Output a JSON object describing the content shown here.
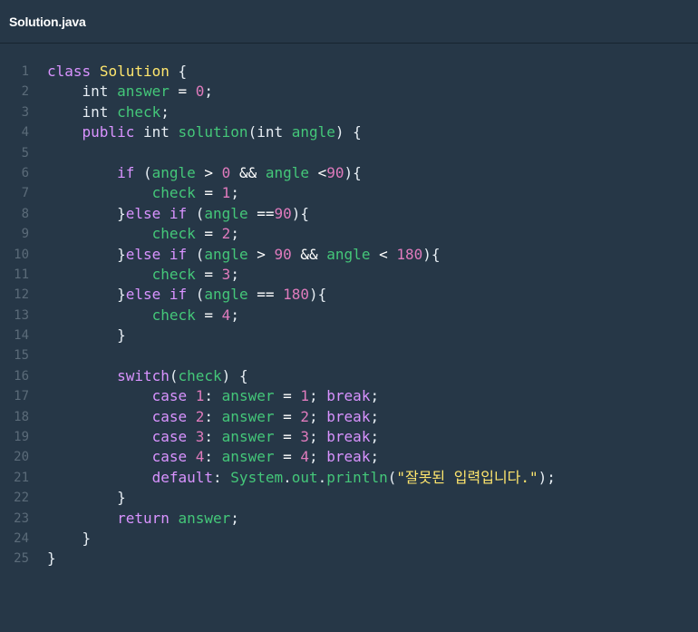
{
  "file_tab": {
    "title": "Solution.java"
  },
  "colors": {
    "background": "#263747",
    "keyword": "#d993ff",
    "class_name": "#ffe66d",
    "variable": "#44c779",
    "number": "#e07bbd",
    "string": "#ffe66d",
    "line_number": "#5b6b79"
  },
  "lines": [
    {
      "n": "1",
      "tokens": [
        [
          "kw",
          "class"
        ],
        [
          "plain",
          " "
        ],
        [
          "cls",
          "Solution"
        ],
        [
          "plain",
          " {"
        ]
      ]
    },
    {
      "n": "2",
      "tokens": [
        [
          "plain",
          "    int "
        ],
        [
          "var",
          "answer"
        ],
        [
          "op",
          " = "
        ],
        [
          "num",
          "0"
        ],
        [
          "plain",
          ";"
        ]
      ]
    },
    {
      "n": "3",
      "tokens": [
        [
          "plain",
          "    int "
        ],
        [
          "var",
          "check"
        ],
        [
          "plain",
          ";"
        ]
      ]
    },
    {
      "n": "4",
      "tokens": [
        [
          "plain",
          "    "
        ],
        [
          "kw",
          "public"
        ],
        [
          "plain",
          " int "
        ],
        [
          "var",
          "solution"
        ],
        [
          "plain",
          "(int "
        ],
        [
          "var",
          "angle"
        ],
        [
          "plain",
          ") {"
        ]
      ]
    },
    {
      "n": "5",
      "tokens": []
    },
    {
      "n": "6",
      "tokens": [
        [
          "plain",
          "        "
        ],
        [
          "kw",
          "if"
        ],
        [
          "plain",
          " ("
        ],
        [
          "var",
          "angle"
        ],
        [
          "op",
          " > "
        ],
        [
          "num",
          "0"
        ],
        [
          "op",
          " && "
        ],
        [
          "var",
          "angle"
        ],
        [
          "op",
          " <"
        ],
        [
          "num",
          "90"
        ],
        [
          "plain",
          "){"
        ]
      ]
    },
    {
      "n": "7",
      "tokens": [
        [
          "plain",
          "            "
        ],
        [
          "var",
          "check"
        ],
        [
          "op",
          " = "
        ],
        [
          "num",
          "1"
        ],
        [
          "plain",
          ";"
        ]
      ]
    },
    {
      "n": "8",
      "tokens": [
        [
          "plain",
          "        }"
        ],
        [
          "kw",
          "else if"
        ],
        [
          "plain",
          " ("
        ],
        [
          "var",
          "angle"
        ],
        [
          "op",
          " =="
        ],
        [
          "num",
          "90"
        ],
        [
          "plain",
          "){"
        ]
      ]
    },
    {
      "n": "9",
      "tokens": [
        [
          "plain",
          "            "
        ],
        [
          "var",
          "check"
        ],
        [
          "op",
          " = "
        ],
        [
          "num",
          "2"
        ],
        [
          "plain",
          ";"
        ]
      ]
    },
    {
      "n": "10",
      "tokens": [
        [
          "plain",
          "        }"
        ],
        [
          "kw",
          "else if"
        ],
        [
          "plain",
          " ("
        ],
        [
          "var",
          "angle"
        ],
        [
          "op",
          " > "
        ],
        [
          "num",
          "90"
        ],
        [
          "op",
          " && "
        ],
        [
          "var",
          "angle"
        ],
        [
          "op",
          " < "
        ],
        [
          "num",
          "180"
        ],
        [
          "plain",
          "){"
        ]
      ]
    },
    {
      "n": "11",
      "tokens": [
        [
          "plain",
          "            "
        ],
        [
          "var",
          "check"
        ],
        [
          "op",
          " = "
        ],
        [
          "num",
          "3"
        ],
        [
          "plain",
          ";"
        ]
      ]
    },
    {
      "n": "12",
      "tokens": [
        [
          "plain",
          "        }"
        ],
        [
          "kw",
          "else if"
        ],
        [
          "plain",
          " ("
        ],
        [
          "var",
          "angle"
        ],
        [
          "op",
          " == "
        ],
        [
          "num",
          "180"
        ],
        [
          "plain",
          "){"
        ]
      ]
    },
    {
      "n": "13",
      "tokens": [
        [
          "plain",
          "            "
        ],
        [
          "var",
          "check"
        ],
        [
          "op",
          " = "
        ],
        [
          "num",
          "4"
        ],
        [
          "plain",
          ";"
        ]
      ]
    },
    {
      "n": "14",
      "tokens": [
        [
          "plain",
          "        }"
        ]
      ]
    },
    {
      "n": "15",
      "tokens": []
    },
    {
      "n": "16",
      "tokens": [
        [
          "plain",
          "        "
        ],
        [
          "kw",
          "switch"
        ],
        [
          "plain",
          "("
        ],
        [
          "var",
          "check"
        ],
        [
          "plain",
          ") {"
        ]
      ]
    },
    {
      "n": "17",
      "tokens": [
        [
          "plain",
          "            "
        ],
        [
          "kw",
          "case"
        ],
        [
          "plain",
          " "
        ],
        [
          "num",
          "1"
        ],
        [
          "plain",
          ": "
        ],
        [
          "var",
          "answer"
        ],
        [
          "op",
          " = "
        ],
        [
          "num",
          "1"
        ],
        [
          "plain",
          "; "
        ],
        [
          "kw",
          "break"
        ],
        [
          "plain",
          ";"
        ]
      ]
    },
    {
      "n": "18",
      "tokens": [
        [
          "plain",
          "            "
        ],
        [
          "kw",
          "case"
        ],
        [
          "plain",
          " "
        ],
        [
          "num",
          "2"
        ],
        [
          "plain",
          ": "
        ],
        [
          "var",
          "answer"
        ],
        [
          "op",
          " = "
        ],
        [
          "num",
          "2"
        ],
        [
          "plain",
          "; "
        ],
        [
          "kw",
          "break"
        ],
        [
          "plain",
          ";"
        ]
      ]
    },
    {
      "n": "19",
      "tokens": [
        [
          "plain",
          "            "
        ],
        [
          "kw",
          "case"
        ],
        [
          "plain",
          " "
        ],
        [
          "num",
          "3"
        ],
        [
          "plain",
          ": "
        ],
        [
          "var",
          "answer"
        ],
        [
          "op",
          " = "
        ],
        [
          "num",
          "3"
        ],
        [
          "plain",
          "; "
        ],
        [
          "kw",
          "break"
        ],
        [
          "plain",
          ";"
        ]
      ]
    },
    {
      "n": "20",
      "tokens": [
        [
          "plain",
          "            "
        ],
        [
          "kw",
          "case"
        ],
        [
          "plain",
          " "
        ],
        [
          "num",
          "4"
        ],
        [
          "plain",
          ": "
        ],
        [
          "var",
          "answer"
        ],
        [
          "op",
          " = "
        ],
        [
          "num",
          "4"
        ],
        [
          "plain",
          "; "
        ],
        [
          "kw",
          "break"
        ],
        [
          "plain",
          ";"
        ]
      ]
    },
    {
      "n": "21",
      "tokens": [
        [
          "plain",
          "            "
        ],
        [
          "kw",
          "default"
        ],
        [
          "plain",
          ": "
        ],
        [
          "var",
          "System"
        ],
        [
          "plain",
          "."
        ],
        [
          "var",
          "out"
        ],
        [
          "plain",
          "."
        ],
        [
          "var",
          "println"
        ],
        [
          "plain",
          "("
        ],
        [
          "str",
          "\"잘못된 입력입니다.\""
        ],
        [
          "plain",
          ");"
        ]
      ]
    },
    {
      "n": "22",
      "tokens": [
        [
          "plain",
          "        }"
        ]
      ]
    },
    {
      "n": "23",
      "tokens": [
        [
          "plain",
          "        "
        ],
        [
          "kw",
          "return"
        ],
        [
          "plain",
          " "
        ],
        [
          "var",
          "answer"
        ],
        [
          "plain",
          ";"
        ]
      ]
    },
    {
      "n": "24",
      "tokens": [
        [
          "plain",
          "    }"
        ]
      ]
    },
    {
      "n": "25",
      "tokens": [
        [
          "plain",
          "}"
        ]
      ]
    }
  ]
}
